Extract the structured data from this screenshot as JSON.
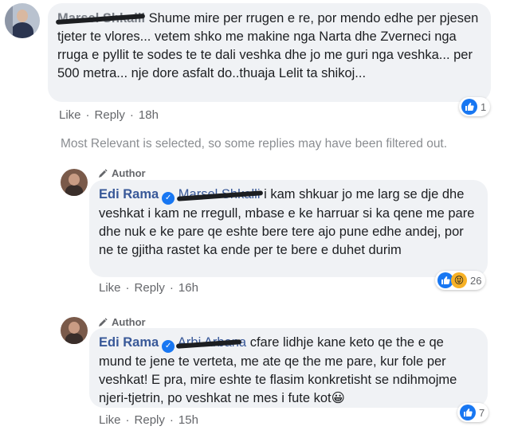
{
  "comment1": {
    "name": "Marsel Shkalli",
    "text": "Shume mire per rrugen e re, por mendo edhe per pjesen tjeter te vlores... vetem shko me makine nga Narta dhe Zverneci nga rruga e pyllit te sodes te te dali veshka dhe jo me guri nga veshka... per 500 metra... nje dore asfalt do..thuaja Lelit ta shikoj...",
    "like": "Like",
    "reply": "Reply",
    "time": "18h",
    "reaction_count": "1"
  },
  "filter_note": "Most Relevant is selected, so some replies may have been filtered out.",
  "reply1": {
    "badge": "Author",
    "name": "Edi Rama",
    "mention": "Marsel Shkalli",
    "text": "i kam shkuar jo me larg se dje dhe veshkat i kam ne rregull, mbase e ke harruar si ka qene me pare dhe nuk e ke pare qe eshte bere tere ajo pune edhe andej, por ne te gjitha rastet ka ende per te bere e duhet durim",
    "like": "Like",
    "reply": "Reply",
    "time": "16h",
    "reaction_count": "26"
  },
  "reply2": {
    "badge": "Author",
    "name": "Edi Rama",
    "mention": "Arbi Arbana",
    "text": "cfare lidhje kane keto qe the e qe mund te jene te verteta, me ate qe the me pare, kur fole per veshkat! E pra, mire eshte te flasim konkretisht se ndihmojme njeri-tjetrin, po veshkat ne mes i fute kot",
    "emoji": "😀",
    "like": "Like",
    "reply": "Reply",
    "time": "15h",
    "reaction_count": "7"
  },
  "colors": {
    "bubble": "#f0f2f5",
    "name": "#385898",
    "like_blue": "#1877f2",
    "muted": "#65676b"
  }
}
